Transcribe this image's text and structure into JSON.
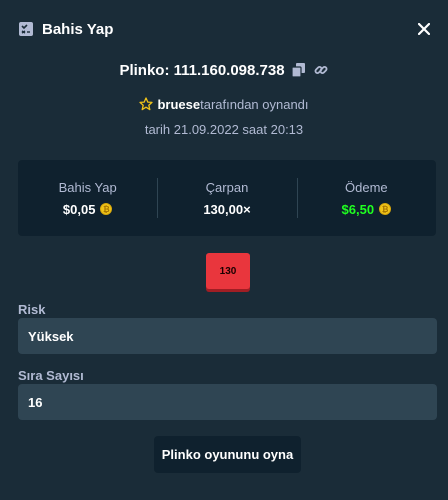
{
  "header": {
    "title": "Bahis Yap",
    "title_icon": "bet-slip-icon",
    "close_icon": "close-icon"
  },
  "game": {
    "id_text": "Plinko: 111.160.098.738",
    "copy_icon": "copy-icon",
    "link_icon": "link-icon"
  },
  "player": {
    "username": "bruese",
    "suffix": "tarafından oynandı",
    "star_icon": "star-icon"
  },
  "date_text": "tarih 21.09.2022 saat 20:13",
  "stats": {
    "bet_label": "Bahis Yap",
    "bet_value": "$0,05",
    "multiplier_label": "Çarpan",
    "multiplier_value": "130,00×",
    "payout_label": "Ödeme",
    "payout_value": "$6,50",
    "payout_color": "#1fff20",
    "coin_icon": "coin-icon"
  },
  "result_slot": {
    "label": "130",
    "color": "#e9363d"
  },
  "risk": {
    "label": "Risk",
    "value": "Yüksek"
  },
  "rows": {
    "label": "Sıra Sayısı",
    "value": "16"
  },
  "play_button": "Plinko oyununu oyna"
}
